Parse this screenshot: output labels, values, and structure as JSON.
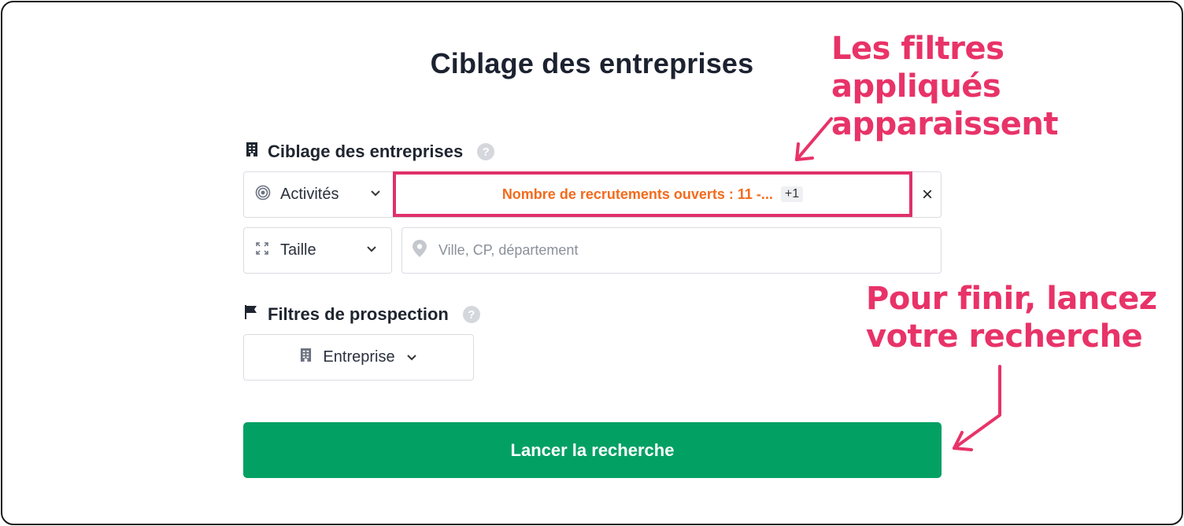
{
  "page": {
    "title": "Ciblage des entreprises"
  },
  "section_targeting": {
    "label": "Ciblage des entreprises",
    "help": "?",
    "activities_select": {
      "label": "Activités"
    },
    "applied_filter": {
      "text": "Nombre de recrutements ouverts : 11 -...",
      "extra_badge": "+1"
    },
    "clear": "×",
    "size_select": {
      "label": "Taille"
    },
    "location_input": {
      "placeholder": "Ville, CP, département",
      "value": ""
    }
  },
  "section_prospecting": {
    "label": "Filtres de prospection",
    "help": "?",
    "entity_select": {
      "label": "Entreprise"
    }
  },
  "actions": {
    "search_label": "Lancer la recherche"
  },
  "annotations": {
    "top": {
      "line1": "Les filtres appliqués",
      "line2": "apparaissent"
    },
    "bottom": {
      "line1": "Pour finir, lancez",
      "line2": "votre recherche"
    }
  },
  "colors": {
    "accent_annotation": "#e83368",
    "filter_text": "#f26b1d",
    "search_button": "#03a064",
    "frame_border": "#1a1a1a"
  },
  "icons": [
    "building-icon",
    "help-icon",
    "target-icon",
    "chevron-down-icon",
    "close-icon",
    "expand-icon",
    "location-pin-icon",
    "flag-icon"
  ]
}
